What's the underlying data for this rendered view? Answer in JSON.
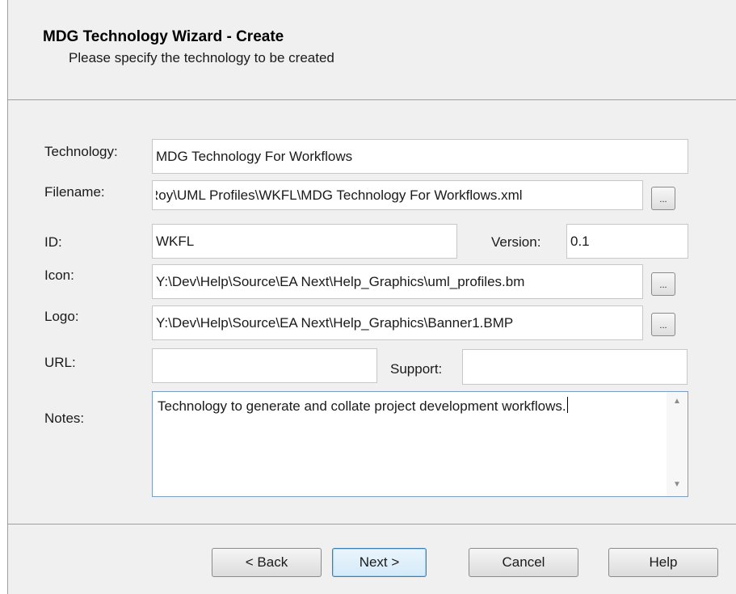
{
  "header": {
    "title": "MDG Technology Wizard - Create",
    "subtitle": "Please specify the technology to be created"
  },
  "form": {
    "technology": {
      "label": "Technology:",
      "value": "MDG Technology For Workflows"
    },
    "filename": {
      "label": "Filename:",
      "value": "Roy\\UML Profiles\\WKFL\\MDG Technology For Workflows.xml"
    },
    "id": {
      "label": "ID:",
      "value": "WKFL"
    },
    "version": {
      "label": "Version:",
      "value": "0.1"
    },
    "icon": {
      "label": "Icon:",
      "value": "Y:\\Dev\\Help\\Source\\EA Next\\Help_Graphics\\uml_profiles.bm"
    },
    "logo": {
      "label": "Logo:",
      "value": "Y:\\Dev\\Help\\Source\\EA Next\\Help_Graphics\\Banner1.BMP"
    },
    "url": {
      "label": "URL:",
      "value": ""
    },
    "support": {
      "label": "Support:",
      "value": ""
    },
    "notes": {
      "label": "Notes:",
      "value": "Technology to generate and collate project development workflows."
    },
    "browse_label": "..."
  },
  "buttons": {
    "back": "< Back",
    "next": "Next >",
    "cancel": "Cancel",
    "help": "Help"
  },
  "icons": {
    "scroll_up": "scroll-up-arrow-icon",
    "scroll_down": "scroll-down-arrow-icon"
  }
}
